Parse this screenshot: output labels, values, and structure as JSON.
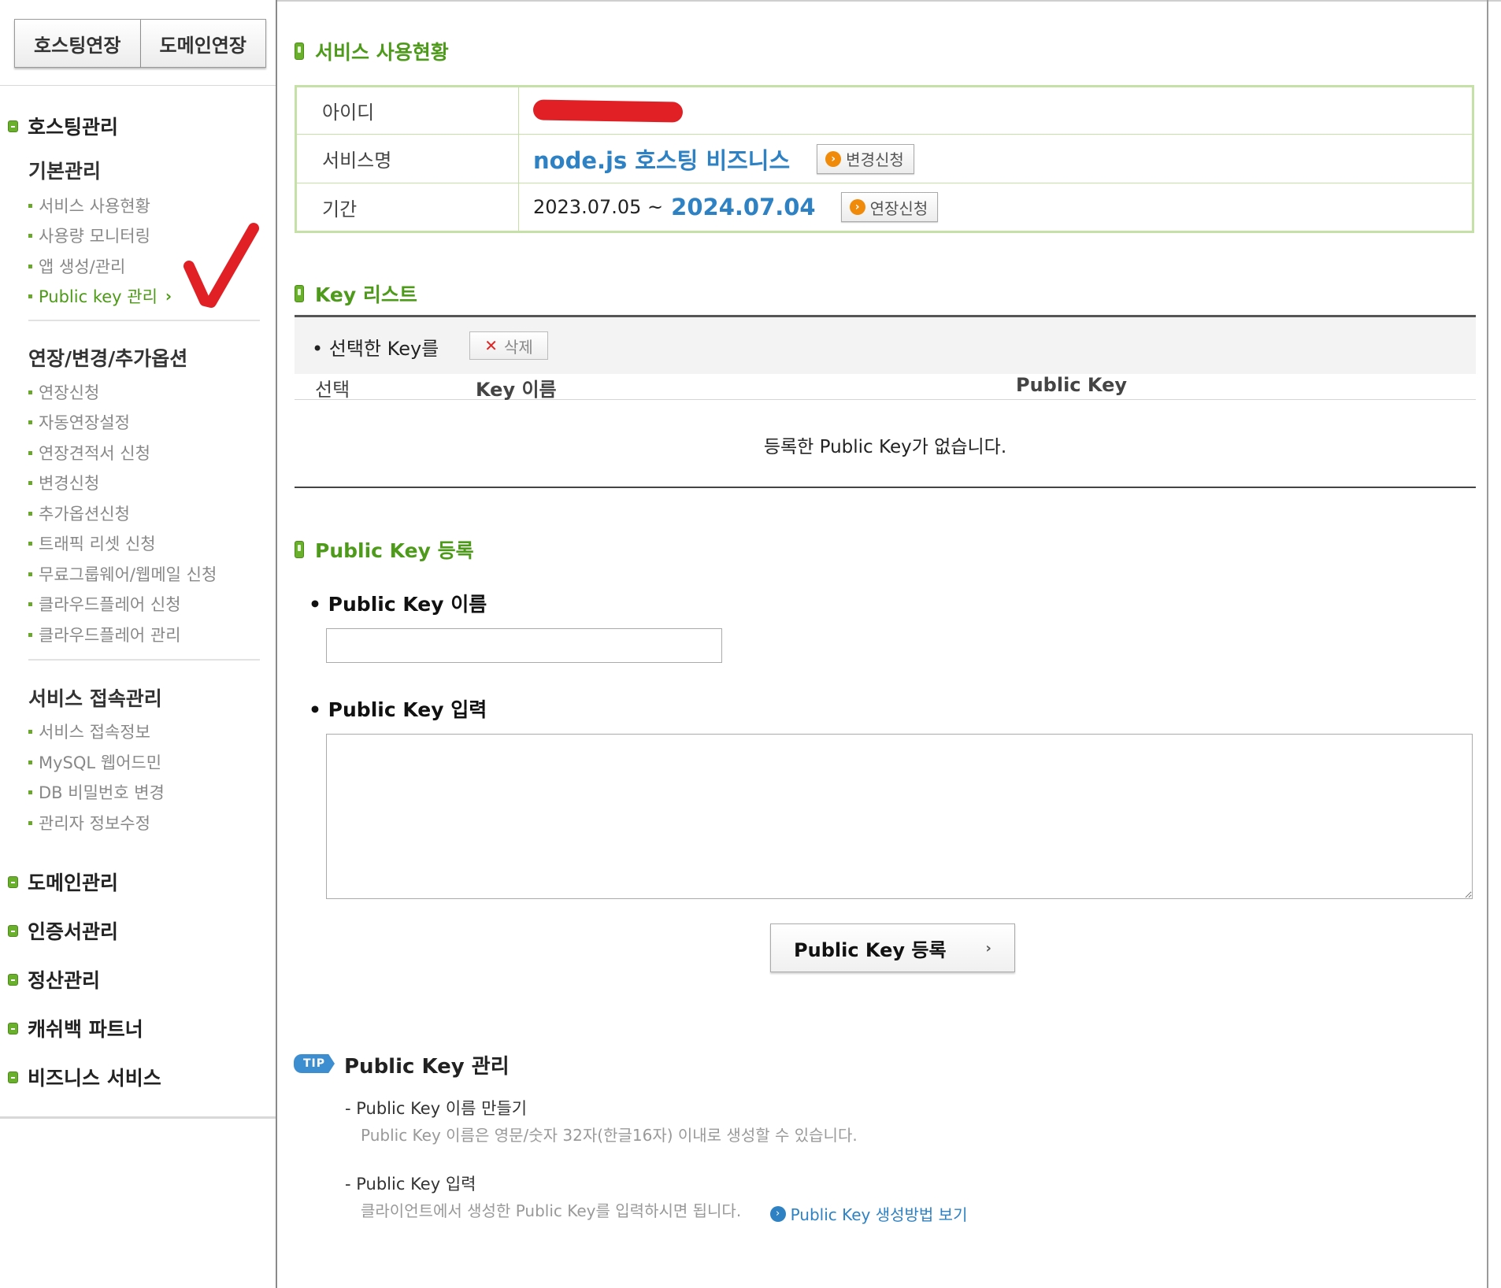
{
  "sidebar": {
    "extend_buttons": [
      "호스팅연장",
      "도메인연장"
    ],
    "categories": {
      "hosting": "호스팅관리",
      "domain": "도메인관리",
      "cert": "인증서관리",
      "billing": "정산관리",
      "cashback": "캐쉬백 파트너",
      "business": "비즈니스 서비스"
    },
    "groups": {
      "basic": {
        "title": "기본관리",
        "items": [
          "서비스 사용현황",
          "사용량 모니터링",
          "앱 생성/관리",
          "Public key 관리"
        ]
      },
      "extend": {
        "title": "연장/변경/추가옵션",
        "items": [
          "연장신청",
          "자동연장설정",
          "연장견적서 신청",
          "변경신청",
          "추가옵션신청",
          "트래픽 리셋 신청",
          "무료그룹웨어/웹메일 신청",
          "클라우드플레어 신청",
          "클라우드플레어 관리"
        ]
      },
      "access": {
        "title": "서비스 접속관리",
        "items": [
          "서비스 접속정보",
          "MySQL 웹어드민",
          "DB 비밀번호 변경",
          "관리자 정보수정"
        ]
      }
    },
    "active_item": "Public key 관리",
    "annotation_color": "#e02024"
  },
  "status": {
    "title": "서비스 사용현황",
    "rows": {
      "id_label": "아이디",
      "service_label": "서비스명",
      "service_name": "node.js 호스팅 비즈니스",
      "change_button": "변경신청",
      "period_label": "기간",
      "period_start": "2023.07.05 ~",
      "period_end": "2024.07.04",
      "extend_button": "연장신청"
    }
  },
  "keylist": {
    "title": "Key 리스트",
    "selected_label": "• 선택한 Key를",
    "delete_button": "삭제",
    "columns": [
      "선택",
      "Key 이름",
      "Public Key"
    ],
    "empty_message": "등록한 Public Key가 없습니다."
  },
  "register": {
    "title": "Public Key 등록",
    "name_label": "• Public Key 이름",
    "name_value": "",
    "key_label": "• Public Key 입력",
    "key_value": "",
    "submit_button": "Public Key 등록"
  },
  "tip": {
    "badge": "TIP",
    "title": "Public Key 관리",
    "items": [
      {
        "head": "- Public Key 이름 만들기",
        "desc": "Public Key 이름은 영문/숫자 32자(한글16자) 이내로 생성할 수 있습니다."
      },
      {
        "head": "- Public Key 입력",
        "desc": "클라이언트에서 생성한 Public Key를 입력하시면 됩니다."
      }
    ],
    "guide_link": "Public Key 생성방법 보기"
  },
  "colors": {
    "accent_green": "#4e9a1b",
    "accent_blue": "#2e82c4",
    "table_border": "#c5e1a8"
  }
}
